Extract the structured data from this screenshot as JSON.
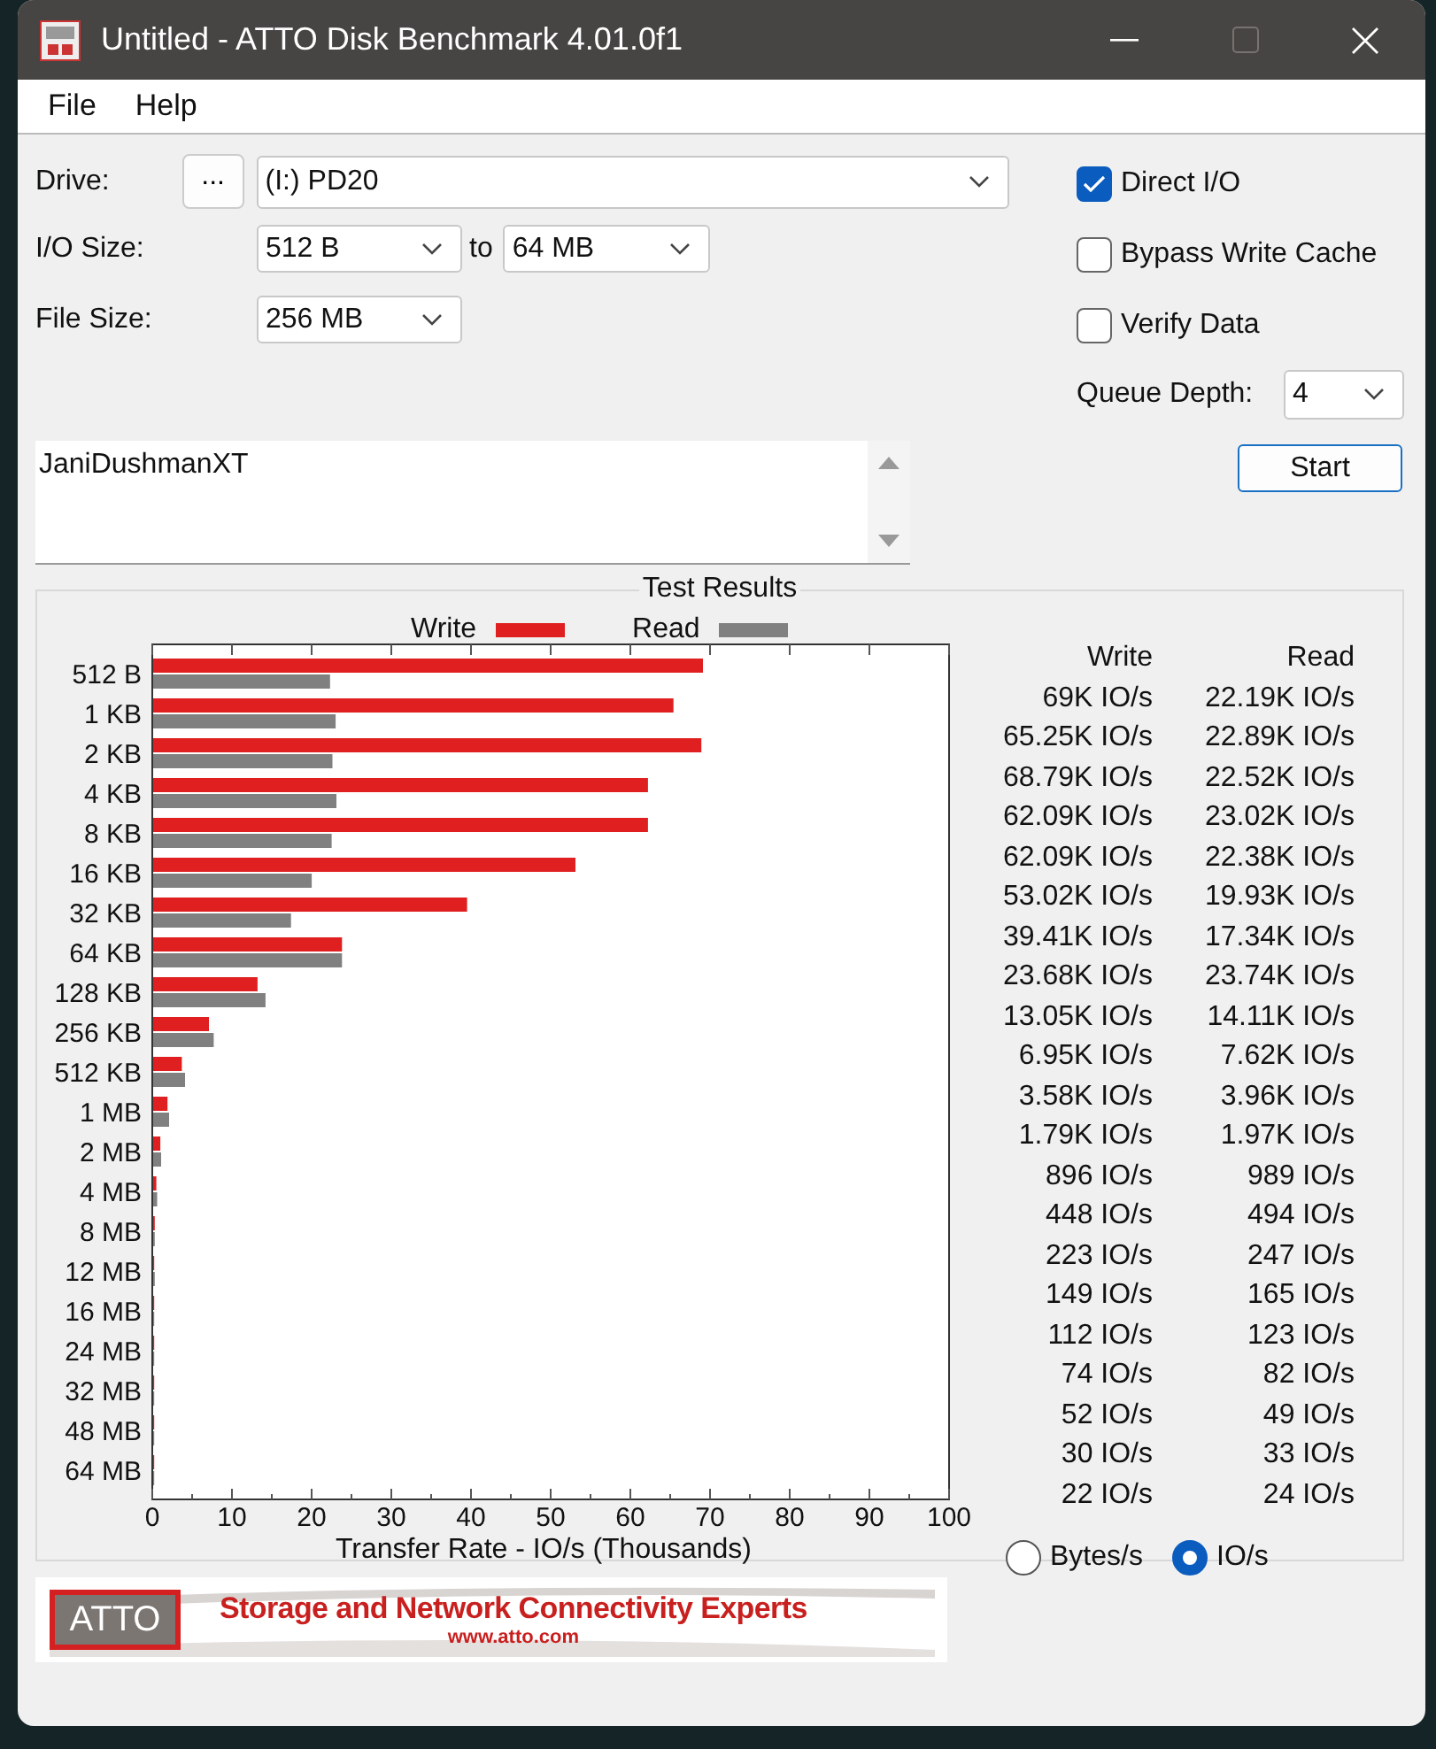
{
  "window": {
    "title": "Untitled - ATTO Disk Benchmark 4.01.0f1",
    "maximize_disabled": true
  },
  "menu": [
    "File",
    "Help"
  ],
  "drive": {
    "label": "Drive:",
    "browse": "...",
    "value": "(I:) PD20"
  },
  "io_size": {
    "label": "I/O Size:",
    "from": "512 B",
    "to_label": "to",
    "to": "64 MB"
  },
  "file_size": {
    "label": "File Size:",
    "value": "256 MB"
  },
  "options": [
    {
      "label": "Direct I/O",
      "checked": true
    },
    {
      "label": "Bypass Write Cache",
      "checked": false
    },
    {
      "label": "Verify Data",
      "checked": false
    }
  ],
  "queue_depth": {
    "label": "Queue Depth:",
    "value": "4"
  },
  "start_button": "Start",
  "description": "JaniDushmanXT",
  "results": {
    "title": "Test Results",
    "columns": [
      "Write",
      "Read"
    ],
    "rows": [
      {
        "write": "69K IO/s",
        "read": "22.19K IO/s"
      },
      {
        "write": "65.25K IO/s",
        "read": "22.89K IO/s"
      },
      {
        "write": "68.79K IO/s",
        "read": "22.52K IO/s"
      },
      {
        "write": "62.09K IO/s",
        "read": "23.02K IO/s"
      },
      {
        "write": "62.09K IO/s",
        "read": "22.38K IO/s"
      },
      {
        "write": "53.02K IO/s",
        "read": "19.93K IO/s"
      },
      {
        "write": "39.41K IO/s",
        "read": "17.34K IO/s"
      },
      {
        "write": "23.68K IO/s",
        "read": "23.74K IO/s"
      },
      {
        "write": "13.05K IO/s",
        "read": "14.11K IO/s"
      },
      {
        "write": "6.95K IO/s",
        "read": "7.62K IO/s"
      },
      {
        "write": "3.58K IO/s",
        "read": "3.96K IO/s"
      },
      {
        "write": "1.79K IO/s",
        "read": "1.97K IO/s"
      },
      {
        "write": "896 IO/s",
        "read": "989 IO/s"
      },
      {
        "write": "448 IO/s",
        "read": "494 IO/s"
      },
      {
        "write": "223 IO/s",
        "read": "247 IO/s"
      },
      {
        "write": "149 IO/s",
        "read": "165 IO/s"
      },
      {
        "write": "112 IO/s",
        "read": "123 IO/s"
      },
      {
        "write": "74 IO/s",
        "read": "82 IO/s"
      },
      {
        "write": "52 IO/s",
        "read": "49 IO/s"
      },
      {
        "write": "30 IO/s",
        "read": "33 IO/s"
      },
      {
        "write": "22 IO/s",
        "read": "24 IO/s"
      }
    ],
    "chart_data": {
      "type": "bar",
      "orientation": "horizontal",
      "xlabel": "Transfer Rate - IO/s (Thousands)",
      "categories": [
        "512 B",
        "1 KB",
        "2 KB",
        "4 KB",
        "8 KB",
        "16 KB",
        "32 KB",
        "64 KB",
        "128 KB",
        "256 KB",
        "512 KB",
        "1 MB",
        "2 MB",
        "4 MB",
        "8 MB",
        "12 MB",
        "16 MB",
        "24 MB",
        "32 MB",
        "48 MB",
        "64 MB"
      ],
      "series": [
        {
          "name": "Write",
          "color": "#e02020",
          "values": [
            69,
            65.3,
            68.8,
            62.1,
            62.1,
            53,
            39.4,
            23.7,
            13.1,
            7,
            3.6,
            1.8,
            0.9,
            0.4,
            0.2,
            0.1,
            0.1,
            0.1,
            0.1,
            0,
            0
          ]
        },
        {
          "name": "Read",
          "color": "#808080",
          "values": [
            22.2,
            22.9,
            22.5,
            23,
            22.4,
            19.9,
            17.3,
            23.7,
            14.1,
            7.6,
            4,
            2,
            1,
            0.5,
            0.2,
            0.2,
            0.1,
            0.1,
            0,
            0,
            0
          ]
        }
      ],
      "xlim": [
        0,
        100
      ],
      "xticks": [
        0,
        10,
        20,
        30,
        40,
        50,
        60,
        70,
        80,
        90,
        100
      ]
    }
  },
  "units": [
    {
      "label": "Bytes/s",
      "selected": false
    },
    {
      "label": "IO/s",
      "selected": true
    }
  ],
  "banner": {
    "logo": "ATTO",
    "tagline": "Storage and Network Connectivity Experts",
    "url": "www.atto.com"
  }
}
